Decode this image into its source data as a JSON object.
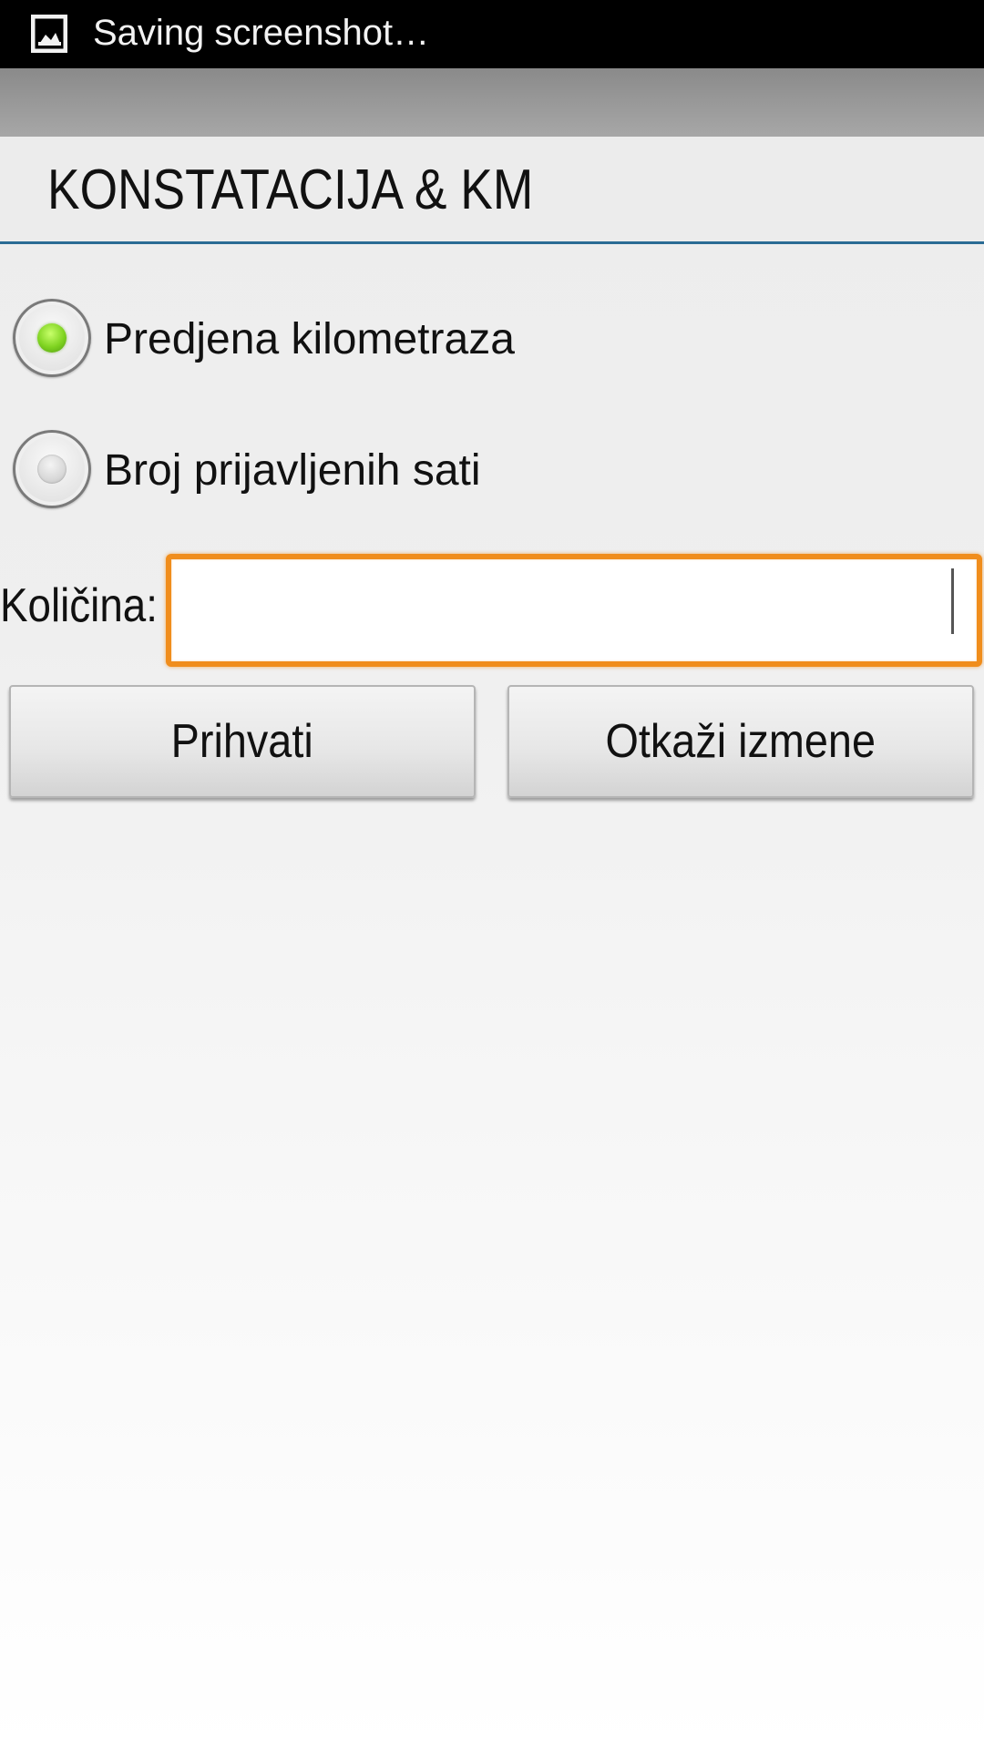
{
  "status_bar": {
    "notification_icon": "image-icon",
    "text": "Saving screenshot…"
  },
  "dialog": {
    "title": "KONSTATACIJA & KM",
    "accent_color": "#2a6b94"
  },
  "options": [
    {
      "label": "Predjena kilometraza",
      "selected": true
    },
    {
      "label": "Broj prijavljenih sati",
      "selected": false
    }
  ],
  "quantity": {
    "label": "Količina:",
    "value": "",
    "focus_color": "#f08d1c"
  },
  "buttons": {
    "accept_label": "Prihvati",
    "cancel_label": "Otkaži izmene"
  }
}
